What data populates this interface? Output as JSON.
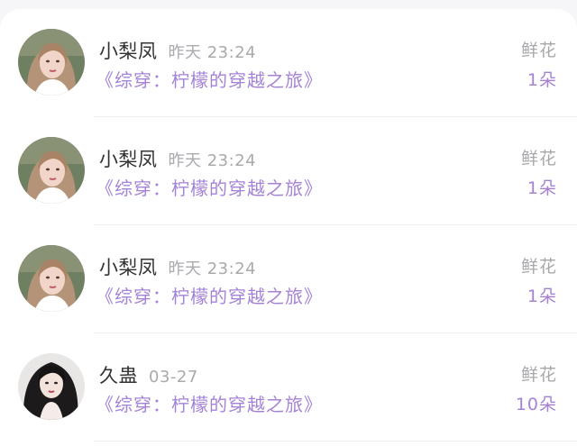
{
  "records": [
    {
      "avatar_icon": "avatar-girl-blonde",
      "user": "小梨凤",
      "time": "昨天 23:24",
      "book": "《综穿：柠檬的穿越之旅》",
      "gift_type": "鲜花",
      "gift_count": "1朵"
    },
    {
      "avatar_icon": "avatar-girl-blonde",
      "user": "小梨凤",
      "time": "昨天 23:24",
      "book": "《综穿：柠檬的穿越之旅》",
      "gift_type": "鲜花",
      "gift_count": "1朵"
    },
    {
      "avatar_icon": "avatar-girl-blonde",
      "user": "小梨凤",
      "time": "昨天 23:24",
      "book": "《综穿：柠檬的穿越之旅》",
      "gift_type": "鲜花",
      "gift_count": "1朵"
    },
    {
      "avatar_icon": "avatar-girl-dark-hair",
      "user": "久蛊",
      "time": "03-27",
      "book": "《综穿：柠檬的穿越之旅》",
      "gift_type": "鲜花",
      "gift_count": "10朵"
    }
  ],
  "colors": {
    "accent_purple": "#a483d6",
    "muted_gray": "#a9a9ae",
    "name_text": "#333333"
  }
}
